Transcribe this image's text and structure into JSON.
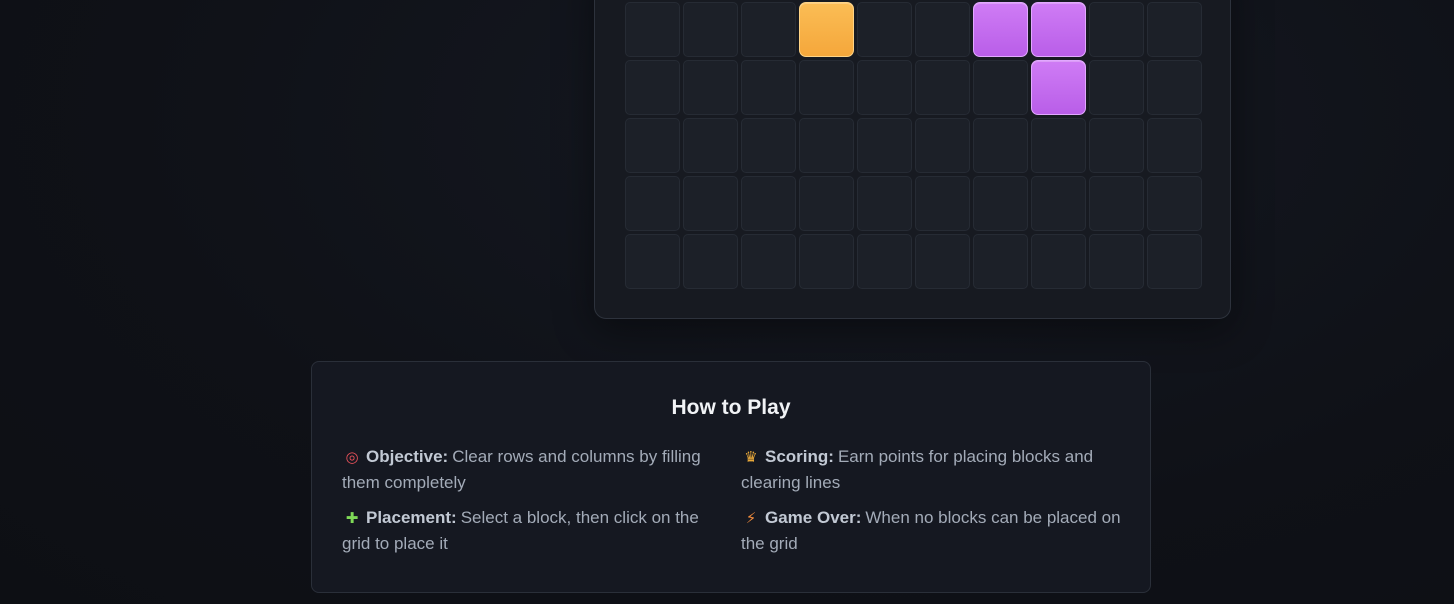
{
  "board": {
    "rows": [
      [
        "",
        "",
        "",
        "orange",
        "",
        "",
        "purple",
        "purple",
        "",
        ""
      ],
      [
        "",
        "",
        "",
        "",
        "",
        "",
        "",
        "purple",
        "",
        ""
      ],
      [
        "",
        "",
        "",
        "",
        "",
        "",
        "",
        "",
        "",
        ""
      ],
      [
        "",
        "",
        "",
        "",
        "",
        "",
        "",
        "",
        "",
        ""
      ],
      [
        "",
        "",
        "",
        "",
        "",
        "",
        "",
        "",
        "",
        ""
      ]
    ],
    "colors": {
      "orange": "#f5a73b",
      "purple": "#b95ee8",
      "empty": "#1c2028"
    }
  },
  "how_to_play": {
    "title": "How to Play",
    "rules": [
      {
        "icon": "target-icon",
        "glyph": "◎",
        "label": "Objective:",
        "text": "Clear rows and columns by filling them completely"
      },
      {
        "icon": "trophy-icon",
        "glyph": "♛",
        "label": "Scoring:",
        "text": "Earn points for placing blocks and clearing lines"
      },
      {
        "icon": "puzzle-icon",
        "glyph": "✚",
        "label": "Placement:",
        "text": "Select a block, then click on the grid to place it"
      },
      {
        "icon": "bolt-icon",
        "glyph": "⚡",
        "label": "Game Over:",
        "text": "When no blocks can be placed on the grid"
      }
    ]
  }
}
